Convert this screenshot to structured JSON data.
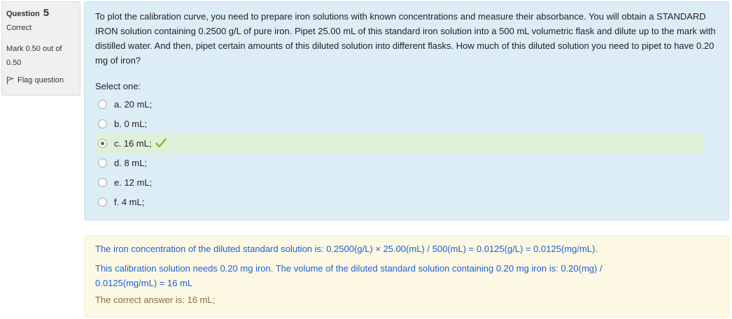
{
  "info": {
    "question_label": "Question",
    "question_number": "5",
    "state": "Correct",
    "grade": "Mark 0.50 out of 0.50",
    "flag_label": "Flag question"
  },
  "question": {
    "text": "To plot the calibration curve, you need to prepare iron solutions with known concentrations and measure their absorbance. You will obtain a STANDARD IRON solution containing 0.2500 g/L of pure iron.  Pipet 25.00 mL of this standard iron solution into a 500 mL volumetric flask and dilute up to the mark with distilled water. And then, pipet certain amounts of this diluted solution into different flasks. How much of this diluted solution you need to pipet to have 0.20 mg of iron?",
    "prompt": "Select one:",
    "answers": [
      {
        "label": "a. 20 mL;",
        "selected": false,
        "correct": false
      },
      {
        "label": "b. 0 mL;",
        "selected": false,
        "correct": false
      },
      {
        "label": "c. 16 mL;",
        "selected": true,
        "correct": true
      },
      {
        "label": "d. 8 mL;",
        "selected": false,
        "correct": false
      },
      {
        "label": "e. 12 mL;",
        "selected": false,
        "correct": false
      },
      {
        "label": "f. 4 mL;",
        "selected": false,
        "correct": false
      }
    ]
  },
  "feedback": {
    "line1": "The iron concentration of the diluted standard solution is: 0.2500(g/L) × 25.00(mL) / 500(mL) = 0.0125(g/L) = 0.0125(mg/mL).",
    "line2": "This calibration solution needs 0.20 mg iron. The volume of the diluted standard solution containing 0.20 mg iron is: 0.20(mg) / 0.0125(mg/mL) = 16 mL",
    "right_answer": "The correct answer is: 16 mL;"
  },
  "colors": {
    "question_bg": "#dcedf6",
    "correct_bg": "#dff0d8",
    "feedback_bg": "#fcf8e3",
    "feedback_text": "#1f5fd6",
    "right_answer_text": "#8a6d3b",
    "tick": "#7ac143"
  }
}
